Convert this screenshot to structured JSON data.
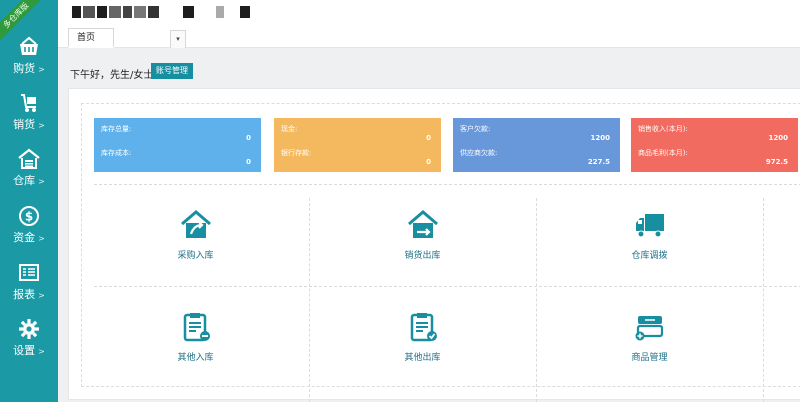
{
  "ribbon": {
    "text": "多仓库版"
  },
  "sidebar": {
    "items": [
      {
        "label": "购货",
        "icon": "basket-icon"
      },
      {
        "label": "销货",
        "icon": "cart-icon"
      },
      {
        "label": "仓库",
        "icon": "warehouse-icon"
      },
      {
        "label": "资金",
        "icon": "dollar-icon"
      },
      {
        "label": "报表",
        "icon": "report-icon"
      },
      {
        "label": "设置",
        "icon": "gear-icon"
      }
    ],
    "arrow": ">"
  },
  "header": {
    "tab_label": "首页",
    "tab_dropdown": "▾"
  },
  "greeting": {
    "text": "下午好，先生/女士",
    "button_label": "账号管理"
  },
  "stats": [
    {
      "label1": "库存总量:",
      "value1": "0",
      "label2": "库存成本:",
      "value2": "0",
      "color": "#5eb1ea"
    },
    {
      "label1": "现金:",
      "value1": "0",
      "label2": "银行存款:",
      "value2": "0",
      "color": "#f4b85e"
    },
    {
      "label1": "客户欠款:",
      "value1": "1200",
      "label2": "供应商欠款:",
      "value2": "227.5",
      "color": "#6897da"
    },
    {
      "label1": "销售收入(本月):",
      "value1": "1200",
      "label2": "商品毛利(本月):",
      "value2": "972.5",
      "color": "#f26b60"
    }
  ],
  "tiles": [
    {
      "label": "采购入库",
      "icon": "purchase-in-icon"
    },
    {
      "label": "销货出库",
      "icon": "sales-out-icon"
    },
    {
      "label": "仓库调拨",
      "icon": "truck-icon"
    },
    {
      "label": "其他入库",
      "icon": "clipboard-in-icon"
    },
    {
      "label": "其他出库",
      "icon": "clipboard-out-icon"
    },
    {
      "label": "商品管理",
      "icon": "goods-icon"
    }
  ]
}
